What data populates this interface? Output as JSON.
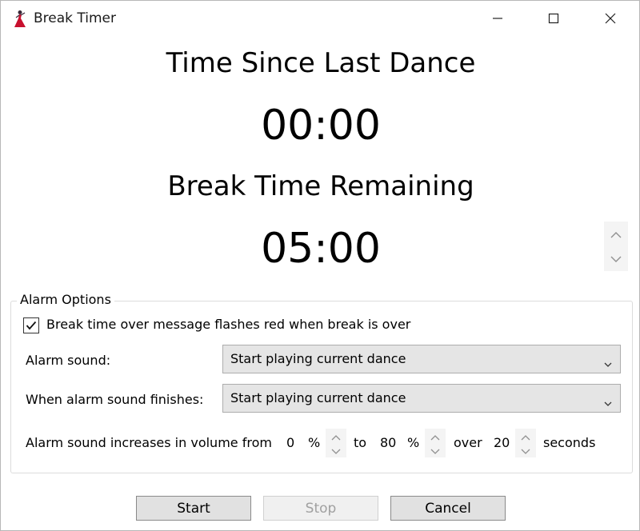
{
  "window": {
    "title": "Break Timer"
  },
  "timers": {
    "since_heading": "Time Since Last Dance",
    "since_value": "00:00",
    "remaining_heading": "Break Time Remaining",
    "remaining_value": "05:00"
  },
  "alarm": {
    "group_label": "Alarm Options",
    "flash_checkbox_label": "Break time over message flashes red when break is over",
    "flash_checked": true,
    "sound_label": "Alarm sound:",
    "sound_value": "Start playing current dance",
    "finish_label": "When alarm sound finishes:",
    "finish_value": "Start playing current dance",
    "volume": {
      "label": "Alarm sound increases in volume from",
      "from_value": "0",
      "from_unit": "%",
      "to_label": "to",
      "to_value": "80",
      "to_unit": "%",
      "over_label": "over",
      "over_value": "20",
      "over_unit": "seconds"
    }
  },
  "buttons": {
    "start": "Start",
    "stop": "Stop",
    "cancel": "Cancel"
  },
  "icons": {
    "app": "dancer-icon",
    "minimize": "minimize-icon",
    "maximize": "maximize-icon",
    "close": "close-icon",
    "spin_up": "chevron-up-icon",
    "spin_down": "chevron-down-icon",
    "check": "checkmark-icon"
  },
  "colors": {
    "app_icon": "#c8102e",
    "combo_bg": "#e5e5e5",
    "button_bg": "#e1e1e1"
  }
}
